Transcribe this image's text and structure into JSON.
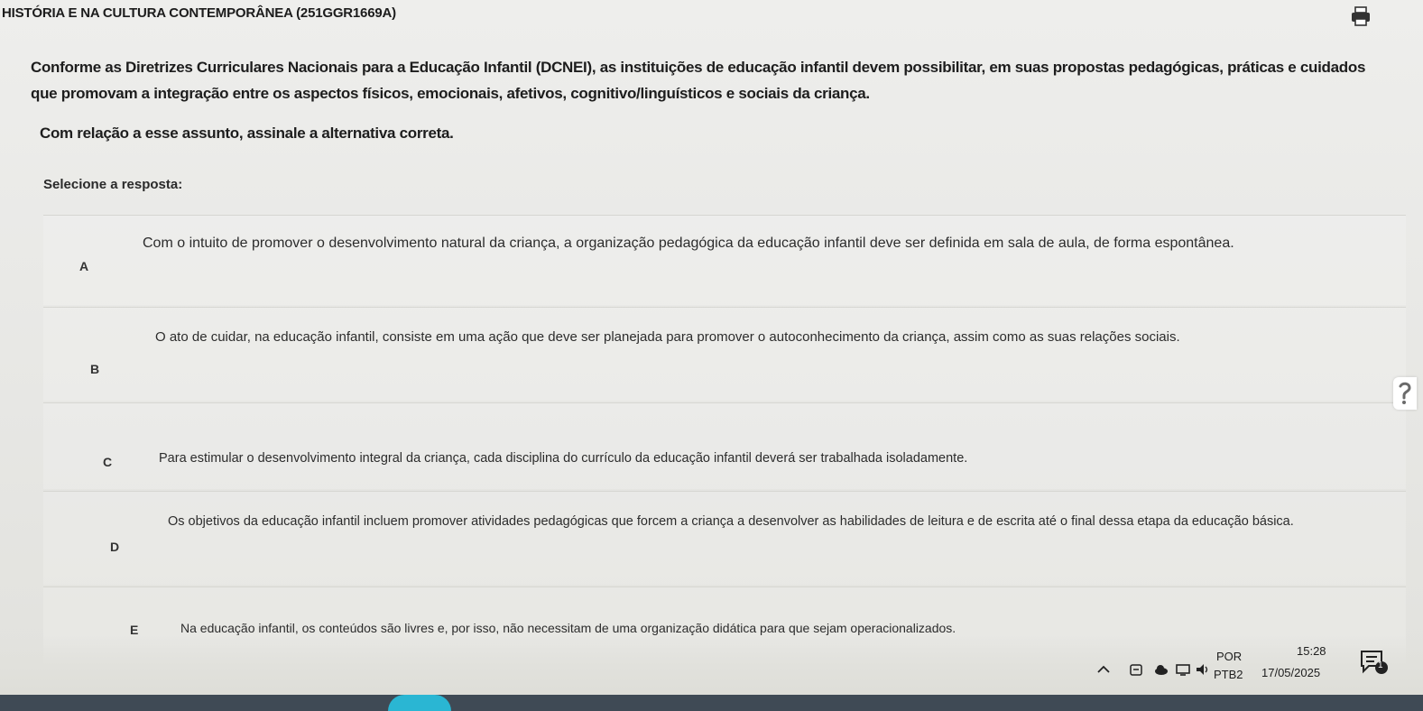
{
  "header": {
    "title": "HISTÓRIA E NA CULTURA CONTEMPORÂNEA (251GGR1669A)",
    "print_icon": "printer-icon"
  },
  "question": {
    "statement": "Conforme as Diretrizes Curriculares Nacionais para a Educação Infantil (DCNEI), as instituições de educação infantil devem possibilitar, em suas propostas pedagógicas, práticas e cuidados que promovam a integração entre os aspectos físicos, emocionais, afetivos, cognitivo/linguísticos e sociais da criança.",
    "prompt": "Com relação a esse assunto, assinale a alternativa correta.",
    "select_label": "Selecione a resposta:"
  },
  "options": [
    {
      "letter": "A",
      "text": "Com o intuito de promover o desenvolvimento natural da criança, a organização pedagógica da educação infantil deve ser definida em sala de aula, de forma espontânea."
    },
    {
      "letter": "B",
      "text": "O ato de cuidar, na educação infantil, consiste em uma ação que deve ser planejada para promover o autoconhecimento da criança, assim como as suas relações sociais."
    },
    {
      "letter": "C",
      "text": "Para estimular o desenvolvimento integral da criança, cada disciplina do currículo da educação infantil deverá ser trabalhada isoladamente."
    },
    {
      "letter": "D",
      "text": "Os objetivos da educação infantil incluem promover atividades pedagógicas que forcem a criança a desenvolver as habilidades de leitura e de escrita até o final dessa etapa da educação básica."
    },
    {
      "letter": "E",
      "text": "Na educação infantil, os conteúdos são livres e, por isso, não necessitam de uma organização didática para que sejam operacionalizados."
    }
  ],
  "taskbar": {
    "lang_line1": "POR",
    "lang_line2": "PTB2",
    "time": "15:28",
    "date": "17/05/2025",
    "notification_count": "1"
  },
  "colors": {
    "page_bg": "#eeeeec",
    "taskbar_strip": "#3f4a55",
    "accent_cyan": "#2ab6d3"
  }
}
